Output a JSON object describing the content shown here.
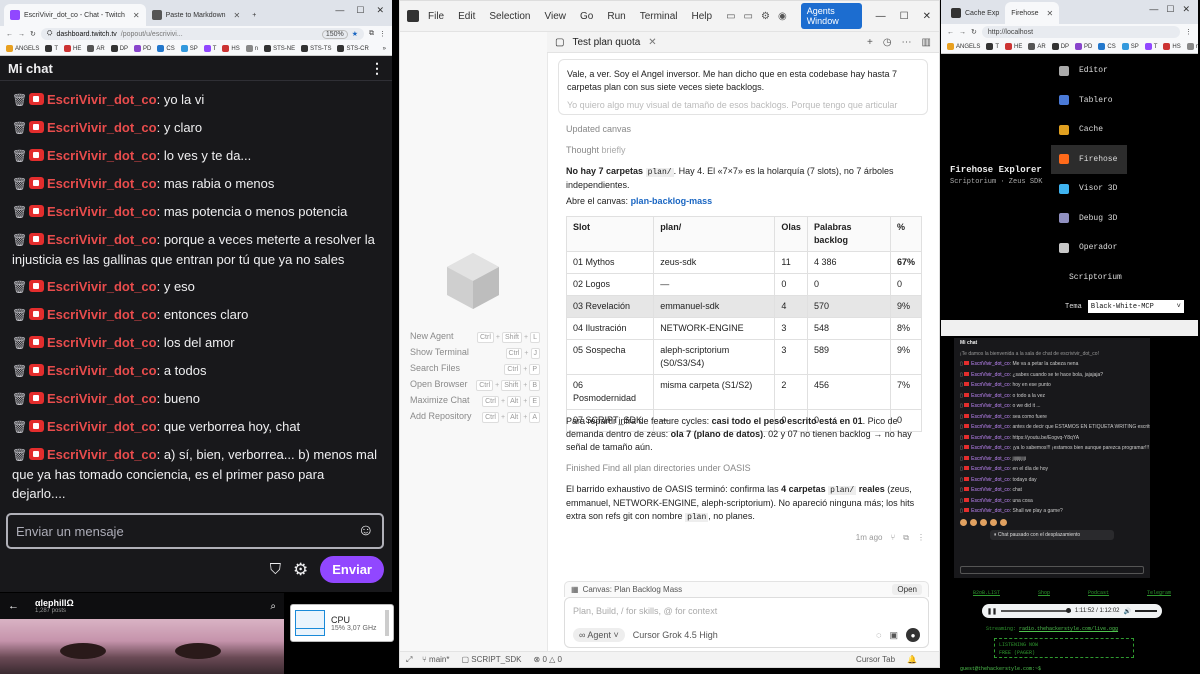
{
  "twitch": {
    "tabs": [
      {
        "label": "EscriVivir_dot_co - Chat - Twitch",
        "color": "#9147ff"
      },
      {
        "label": "Paste to Markdown",
        "color": "#555555"
      }
    ],
    "url_host": "dashboard.twitch.tv",
    "url_path": "/popout/u/escrivivi...",
    "zoom": "150%",
    "bookmarks": [
      "ANGELS",
      "T",
      "HE",
      "AR",
      "DP",
      "PD",
      "CS",
      "SP",
      "T",
      "HS",
      "n",
      "STS-NE",
      "STS-TS",
      "STS-CR"
    ],
    "header": "Mi chat",
    "trash_glyph": "🗑",
    "username": "EscriVivir_dot_co",
    "messages": [
      "yo la vi",
      "y claro",
      "lo ves y te da...",
      "mas rabia o menos",
      "mas potencia o menos potencia",
      "porque a veces meterte a resolver la injusticia es las gallinas que entran por tú que ya no sales",
      "y eso",
      "entonces claro",
      "los del amor",
      "a todos",
      "bueno",
      "que verborrea hoy, chat",
      "a) sí, bien, verborrea... b) menos mal que ya has tomado conciencia, es el primer paso para dejarlo...."
    ],
    "input_placeholder": "Enviar un mensaje",
    "send_label": "Enviar",
    "accent": "#9147ff"
  },
  "video": {
    "channel": "αlephillΩ",
    "posts": "1,287 posts"
  },
  "cpu": {
    "label": "CPU",
    "value": "15% 3,07 GHz"
  },
  "vscode": {
    "menu": [
      "File",
      "Edit",
      "Selection",
      "View",
      "Go",
      "Run",
      "Terminal",
      "Help"
    ],
    "agents_button": "Agents Window",
    "tab_title": "Test plan quota",
    "welcome": [
      {
        "label": "New Agent",
        "keys": [
          "Ctrl",
          "+",
          "Shift",
          "+",
          "L"
        ]
      },
      {
        "label": "Show Terminal",
        "keys": [
          "Ctrl",
          "+",
          "J"
        ]
      },
      {
        "label": "Search Files",
        "keys": [
          "Ctrl",
          "+",
          "P"
        ]
      },
      {
        "label": "Open Browser",
        "keys": [
          "Ctrl",
          "+",
          "Shift",
          "+",
          "B"
        ]
      },
      {
        "label": "Maximize Chat",
        "keys": [
          "Ctrl",
          "+",
          "Alt",
          "+",
          "E"
        ]
      },
      {
        "label": "Add Repository",
        "keys": [
          "Ctrl",
          "+",
          "Alt",
          "+",
          "A"
        ]
      }
    ],
    "user_message_1": "Vale, a ver. Soy el Angel inversor. Me han dicho que en esta codebase hay hasta 7 carpetas plan con sus siete veces siete backlogs.",
    "user_message_2": "Yo quiero algo muy visual de tamaño de esos backlogs. Porque tengo que articular reparto",
    "updated_canvas": "Updated canvas",
    "thought": "Thought",
    "thought_suffix": "briefly",
    "answer_bold": "No hay 7 carpetas",
    "answer_code": "plan/",
    "answer_rest": ". Hay 4. El «7×7» es la holarquía (7 slots), no 7 árboles independientes.",
    "open_canvas_prefix": "Abre el canvas:",
    "open_canvas_link": "plan-backlog-mass",
    "table_headers": [
      "Slot",
      "plan/",
      "Olas",
      "Palabras backlog",
      "%"
    ],
    "table_rows": [
      [
        "01 Mythos",
        "zeus-sdk",
        "11",
        "4 386",
        "67%"
      ],
      [
        "02 Logos",
        "—",
        "0",
        "0",
        "0"
      ],
      [
        "03 Revelación",
        "emmanuel-sdk",
        "4",
        "570",
        "9%"
      ],
      [
        "04 Ilustración",
        "NETWORK-ENGINE",
        "3",
        "548",
        "8%"
      ],
      [
        "05 Sospecha",
        "aleph-scriptorium (S0/S3/S4)",
        "3",
        "589",
        "9%"
      ],
      [
        "06 Posmodernidad",
        "misma carpeta (S1/S2)",
        "2",
        "456",
        "7%"
      ],
      [
        "07 SCRIPT_SDK",
        "—",
        "0",
        "0",
        "0"
      ]
    ],
    "para1_a": "Para repartir infra de feature cycles:",
    "para1_b": "casi todo el peso escrito está en 01",
    "para1_c": ". Pico de demanda dentro de zeus:",
    "para1_d": "ola 7 (plano de datos)",
    "para1_e": ". 02 y 07 no tienen backlog → no hay señal de tamaño aún.",
    "finished": "Finished Find all plan directories under OASIS",
    "para2_a": "El barrido exhaustivo de OASIS terminó: confirma las",
    "para2_b": "4 carpetas",
    "para2_code": "plan/",
    "para2_c": "reales",
    "para2_d": "(zeus, emmanuel, NETWORK-ENGINE, aleph-scriptorium). No apareció ninguna más; los hits extra son refs git con nombre",
    "para2_code2": "plan",
    "para2_e": ", no planes.",
    "time_ago": "1m ago",
    "canvas_bar": "Canvas: Plan Backlog Mass",
    "open_button": "Open",
    "composer_placeholder": "Plan, Build, / for skills, @ for context",
    "agent_label": "Agent",
    "model_label": "Cursor Grok 4.5 High",
    "status_branch": "main*",
    "status_folder": "SCRIPT_SDK",
    "status_errors": "0",
    "status_warnings": "0",
    "status_tab": "Cursor Tab"
  },
  "firehose": {
    "tabs": [
      "Cache Exp",
      "Firehose"
    ],
    "url": "http://localhost",
    "bookmarks": [
      "ANGELS",
      "T",
      "HE",
      "AR",
      "DP",
      "PD",
      "CS",
      "SP",
      "T",
      "HS",
      "n"
    ],
    "menu": [
      {
        "label": "Editor",
        "icon_color": "#aaaaaa"
      },
      {
        "label": "Tablero",
        "icon_color": "#4a7ad8"
      },
      {
        "label": "Cache",
        "icon_color": "#e0a020"
      },
      {
        "label": "Firehose",
        "icon_color": "#ff6a1a"
      },
      {
        "label": "Visor 3D",
        "icon_color": "#3fb3f0"
      },
      {
        "label": "Debug 3D",
        "icon_color": "#9090c0"
      },
      {
        "label": "Operador",
        "icon_color": "#c8c8c8"
      },
      {
        "label": "Scriptorium",
        "icon_color": "#e0b050"
      }
    ],
    "active_index": 3,
    "title": "Firehose Explorer",
    "subtitle": "Scriptorium · Zeus SDK",
    "theme_label": "Tema",
    "theme_value": "Black-White-MCP"
  },
  "mini_chat": {
    "header": "Mi chat",
    "welcome": "¡Te damos la bienvenida a la sala de chat de escrivivir_dot_co!",
    "user": "EscriVivir_dot_co",
    "lines": [
      "Me va a petar la cabeza nena",
      "¿sabes cuando se te hace bola, jajajaja?",
      "hoy en ese punto",
      "o todo a la vez",
      "o we did it ...",
      "sea como fuere",
      "antes de decir que ESTAMOS EN ETIQUETA WRITING escritura de twitch",
      "https://youtu.be/Eogvq-Y8qYA",
      "¡ya lo sabemos!!! ¡estamos bien aunque parezca programar!!!",
      "jijijijijiji",
      "en el día de hoy",
      "todays day",
      "chat",
      "una cosa",
      "Shall we play a game?"
    ],
    "paused": "Chat pausado con el desplazamiento"
  },
  "player": {
    "links": [
      "B2oB.LIST",
      "Shop",
      "Podcast",
      "Telegram"
    ],
    "time": "1:11:52 / 1:12:02",
    "stream_label": "Streaming:",
    "stream_url": "radio.thehackerstyle.com/live.ogg",
    "box_line1": "LISTENING NOW",
    "box_line2": "FREE (PAGER)",
    "footer": "guest@thehackerstyle.com:~$"
  }
}
